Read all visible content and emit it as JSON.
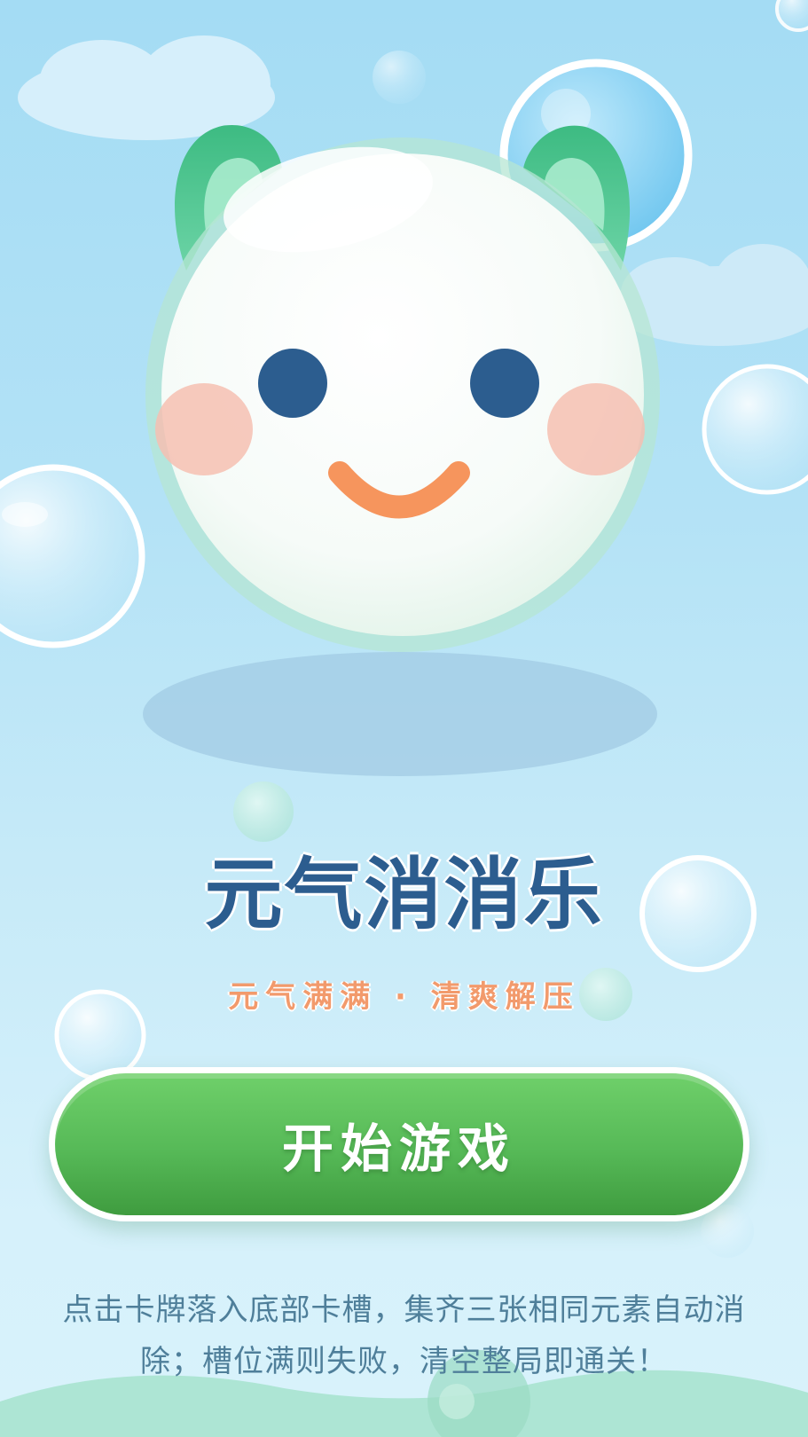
{
  "game": {
    "title": "元气消消乐",
    "subtitle": "元气满满 · 清爽解压",
    "start_button_label": "开始游戏",
    "instructions_line1": "点击卡牌落入底部卡槽，集齐三张相同元素自动消",
    "instructions_line2": "除；槽位满则失败，清空整局即通关！"
  },
  "theme": {
    "sky_top": "#a4dcf4",
    "sky_bottom": "#d8f2fb",
    "title_color": "#2c5d8f",
    "subtitle_color": "#f29a6c",
    "button_green": "#56b957",
    "mascot_ear_green": "#48c08a",
    "mascot_eye_color": "#2c5d8f",
    "mascot_mouth_color": "#f6955d",
    "mascot_cheek_color": "#f7c4b6"
  },
  "icons": {
    "mascot": "smiling-bubble-mascot",
    "decor": "floating-bubbles-and-clouds"
  }
}
